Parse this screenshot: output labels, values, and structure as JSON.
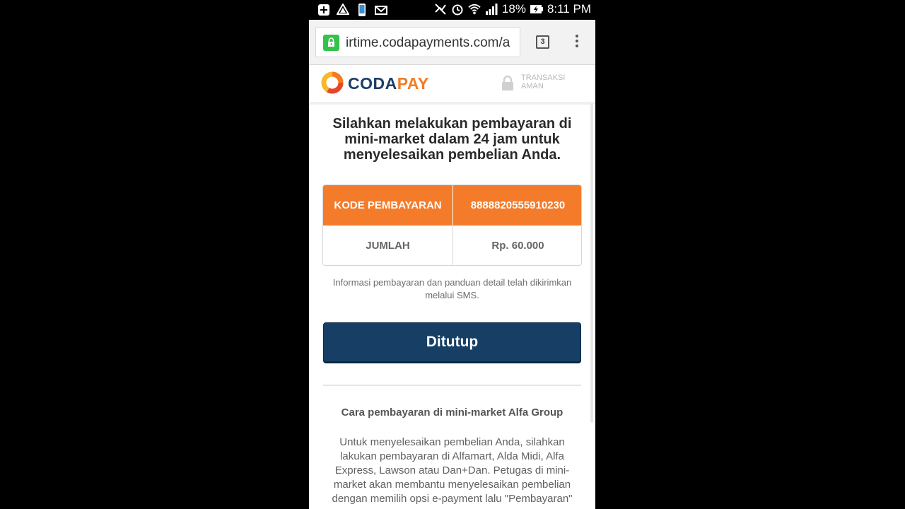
{
  "status_bar": {
    "battery": "18%",
    "time": "8:11 PM"
  },
  "browser": {
    "url": "irtime.codapayments.com/a",
    "tab_count": "3"
  },
  "header": {
    "logo_part1": "CODA",
    "logo_part2": "PAY",
    "secure_line1": "TRANSAKSI",
    "secure_line2": "AMAN"
  },
  "main": {
    "heading": "Silahkan melakukan pembayaran di mini-market dalam 24 jam untuk menyelesaikan pembelian Anda.",
    "table": {
      "code_label": "KODE PEMBAYARAN",
      "code_value": "8888820555910230",
      "amount_label": "JUMLAH",
      "amount_value": "Rp. 60.000"
    },
    "info": "Informasi pembayaran dan panduan detail telah dikirimkan melalui SMS.",
    "close_button": "Ditutup",
    "subheading": "Cara pembayaran di mini-market Alfa Group",
    "body": "Untuk menyelesaikan pembelian Anda, silahkan lakukan pembayaran di Alfamart, Alda Midi, Alfa Express, Lawson atau Dan+Dan. Petugas di mini-market akan membantu menyelesaikan pembelian dengan memilih opsi e-payment lalu \"Pembayaran\""
  },
  "colors": {
    "brand_orange": "#f47b2a",
    "brand_navy": "#173f66",
    "lock_green": "#33c24a"
  },
  "icons": [
    "notification-plus-icon",
    "drive-icon",
    "phone-icon",
    "mail-icon",
    "mute-icon",
    "alarm-icon",
    "wifi-icon",
    "signal-icon",
    "battery-icon",
    "lock-icon",
    "tabs-icon",
    "menu-icon",
    "padlock-icon"
  ]
}
